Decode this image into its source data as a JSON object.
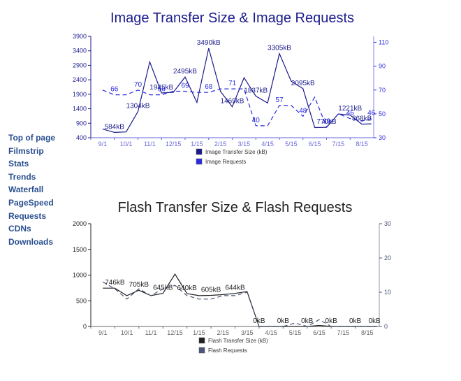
{
  "nav": {
    "items": [
      "Top of page",
      "Filmstrip",
      "Stats",
      "Trends",
      "Waterfall",
      "PageSpeed",
      "Requests",
      "CDNs",
      "Downloads"
    ]
  },
  "chart_data": [
    {
      "type": "line",
      "title": "Image Transfer Size & Image Requests",
      "categories": [
        "9/1",
        "10/1",
        "11/1",
        "12/15",
        "1/15",
        "2/15",
        "3/15",
        "4/15",
        "5/15",
        "6/15",
        "7/15",
        "8/15"
      ],
      "ylim_left": [
        400,
        3900
      ],
      "yticks_left": [
        400,
        900,
        1400,
        1900,
        2400,
        2900,
        3400,
        3900
      ],
      "ylim_right": [
        30,
        115
      ],
      "yticks_right": [
        30,
        50,
        70,
        90,
        110
      ],
      "colors": {
        "size": "#1a1a8c",
        "requests": "#2b2be0",
        "title": "#1a1a8c"
      },
      "series": [
        {
          "name": "Image Transfer Size (kB)",
          "axis": "left",
          "style": "solid",
          "x": [
            0,
            0.5,
            1,
            1.5,
            2,
            2.5,
            3,
            3.5,
            4,
            4.5,
            5,
            5.5,
            6,
            6.5,
            7,
            7.5,
            8,
            8.5,
            9,
            9.5,
            10,
            10.5,
            11,
            11.4
          ],
          "values": [
            700,
            584,
            600,
            1304,
            3020,
            1945,
            1970,
            2495,
            1620,
            3490,
            2000,
            1469,
            2470,
            1837,
            1600,
            3305,
            2350,
            2095,
            750,
            760,
            1221,
            1180,
            868,
            880
          ]
        },
        {
          "name": "Image Requests",
          "axis": "right",
          "style": "dashed",
          "x": [
            0,
            0.5,
            1,
            1.5,
            2,
            2.5,
            3,
            3.5,
            4,
            4.5,
            5,
            5.5,
            6,
            6.5,
            7,
            7.5,
            8,
            8.5,
            9,
            9.5,
            10,
            10.5,
            11,
            11.4
          ],
          "values": [
            70,
            66,
            66,
            70,
            66,
            66,
            69,
            69,
            68,
            68,
            71,
            71,
            71,
            40,
            40,
            57,
            57,
            48,
            64,
            39,
            50,
            46,
            44,
            46
          ]
        }
      ],
      "data_labels": [
        {
          "x": 0.5,
          "y": 584,
          "text": "584kB",
          "color": "#1a1a8c"
        },
        {
          "x": 1.5,
          "y": 1304,
          "text": "1304kB",
          "color": "#1a1a8c"
        },
        {
          "x": 2.5,
          "y": 1945,
          "text": "1945kB",
          "color": "#1a1a8c"
        },
        {
          "x": 3.5,
          "y": 2495,
          "text": "2495kB",
          "color": "#1a1a8c"
        },
        {
          "x": 4.5,
          "y": 3490,
          "text": "3490kB",
          "color": "#1a1a8c"
        },
        {
          "x": 5.5,
          "y": 1469,
          "text": "1469kB",
          "color": "#1a1a8c"
        },
        {
          "x": 6.5,
          "y": 1837,
          "text": "1837kB",
          "color": "#1a1a8c"
        },
        {
          "x": 7.5,
          "y": 3305,
          "text": "3305kB",
          "color": "#1a1a8c"
        },
        {
          "x": 8.5,
          "y": 2095,
          "text": "2095kB",
          "color": "#1a1a8c"
        },
        {
          "x": 9.5,
          "y": 760,
          "text": "770kB",
          "color": "#1a1a8c"
        },
        {
          "x": 10.5,
          "y": 1221,
          "text": "1221kB",
          "color": "#1a1a8c"
        },
        {
          "x": 11.0,
          "y": 868,
          "text": "868kB",
          "color": "#1a1a8c"
        },
        {
          "x": 0.5,
          "y": 66,
          "axis": "right",
          "text": "66",
          "color": "#2b2be0"
        },
        {
          "x": 1.5,
          "y": 70,
          "axis": "right",
          "text": "70",
          "color": "#2b2be0"
        },
        {
          "x": 2.5,
          "y": 66,
          "axis": "right",
          "text": "66",
          "color": "#2b2be0"
        },
        {
          "x": 3.5,
          "y": 69,
          "axis": "right",
          "text": "69",
          "color": "#2b2be0"
        },
        {
          "x": 4.5,
          "y": 68,
          "axis": "right",
          "text": "68",
          "color": "#2b2be0"
        },
        {
          "x": 5.5,
          "y": 71,
          "axis": "right",
          "text": "71",
          "color": "#2b2be0"
        },
        {
          "x": 6.5,
          "y": 40,
          "axis": "right",
          "text": "40",
          "color": "#2b2be0"
        },
        {
          "x": 7.5,
          "y": 57,
          "axis": "right",
          "text": "57",
          "color": "#2b2be0"
        },
        {
          "x": 8.5,
          "y": 48,
          "axis": "right",
          "text": "48",
          "color": "#2b2be0"
        },
        {
          "x": 9.5,
          "y": 39,
          "axis": "right",
          "text": "39",
          "color": "#2b2be0"
        },
        {
          "x": 10.5,
          "y": 46,
          "axis": "right",
          "text": "46",
          "color": "#2b2be0"
        },
        {
          "x": 11.4,
          "y": 46,
          "axis": "right",
          "text": "46",
          "color": "#2b2be0"
        }
      ],
      "legend": {
        "position": "bottom",
        "items": [
          {
            "label": "Image Transfer Size (kB)",
            "color": "#1a1a8c"
          },
          {
            "label": "Image Requests",
            "color": "#2b2be0"
          }
        ]
      }
    },
    {
      "type": "line",
      "title": "Flash Transfer Size & Flash Requests",
      "categories": [
        "9/1",
        "10/1",
        "11/1",
        "12/15",
        "1/15",
        "2/15",
        "3/15",
        "4/15",
        "5/15",
        "6/15",
        "7/15",
        "8/15"
      ],
      "ylim_left": [
        0,
        2000
      ],
      "yticks_left": [
        0,
        500,
        1000,
        1500,
        2000
      ],
      "ylim_right": [
        0,
        30
      ],
      "yticks_right": [
        0,
        10,
        20,
        30
      ],
      "colors": {
        "size": "#222222",
        "requests": "#4a5577",
        "title": "#222222"
      },
      "series": [
        {
          "name": "Flash Transfer Size (kB)",
          "axis": "left",
          "style": "solid",
          "x": [
            0,
            0.5,
            1,
            1.5,
            2,
            2.5,
            3,
            3.5,
            4,
            4.5,
            5,
            5.5,
            6,
            6.5,
            7,
            7.5,
            8,
            8.5,
            9,
            9.5,
            10,
            10.5,
            11,
            11.4
          ],
          "values": [
            746,
            746,
            600,
            705,
            600,
            645,
            1020,
            640,
            600,
            605,
            620,
            644,
            680,
            0,
            0,
            0,
            0,
            0,
            20,
            0,
            0,
            0,
            0,
            0
          ]
        },
        {
          "name": "Flash Requests",
          "axis": "right",
          "style": "dashed",
          "x": [
            0,
            0.5,
            1,
            1.5,
            2,
            2.5,
            3,
            3.5,
            4,
            4.5,
            5,
            5.5,
            6,
            6.5,
            7,
            7.5,
            8,
            8.5,
            9,
            9.5,
            10,
            10.5,
            11,
            11.4
          ],
          "values": [
            13,
            11,
            8,
            11,
            9,
            11,
            12,
            9,
            8,
            8,
            9,
            9,
            10,
            0,
            0,
            0,
            1,
            0,
            2,
            0,
            0,
            0,
            0,
            0
          ]
        }
      ],
      "data_labels": [
        {
          "x": 0.5,
          "y": 746,
          "text": "746kB",
          "color": "#222222"
        },
        {
          "x": 1.5,
          "y": 705,
          "text": "705kB",
          "color": "#222222"
        },
        {
          "x": 2.5,
          "y": 645,
          "text": "645kB",
          "color": "#222222"
        },
        {
          "x": 3.5,
          "y": 640,
          "text": "640kB",
          "color": "#222222"
        },
        {
          "x": 4.5,
          "y": 605,
          "text": "605kB",
          "color": "#222222"
        },
        {
          "x": 5.5,
          "y": 644,
          "text": "644kB",
          "color": "#222222"
        },
        {
          "x": 6.5,
          "y": 0,
          "text": "0kB",
          "color": "#222222"
        },
        {
          "x": 7.5,
          "y": 0,
          "text": "0kB",
          "color": "#222222"
        },
        {
          "x": 8.5,
          "y": 0,
          "text": "0kB",
          "color": "#222222"
        },
        {
          "x": 9.5,
          "y": 0,
          "text": "0kB",
          "color": "#222222"
        },
        {
          "x": 10.5,
          "y": 0,
          "text": "0kB",
          "color": "#222222"
        },
        {
          "x": 11.3,
          "y": 0,
          "text": "0kB",
          "color": "#222222"
        }
      ],
      "legend": {
        "position": "bottom",
        "items": [
          {
            "label": "Flash Transfer Size (kB)",
            "color": "#222222"
          },
          {
            "label": "Flash Requests",
            "color": "#4a5577"
          }
        ]
      }
    }
  ]
}
